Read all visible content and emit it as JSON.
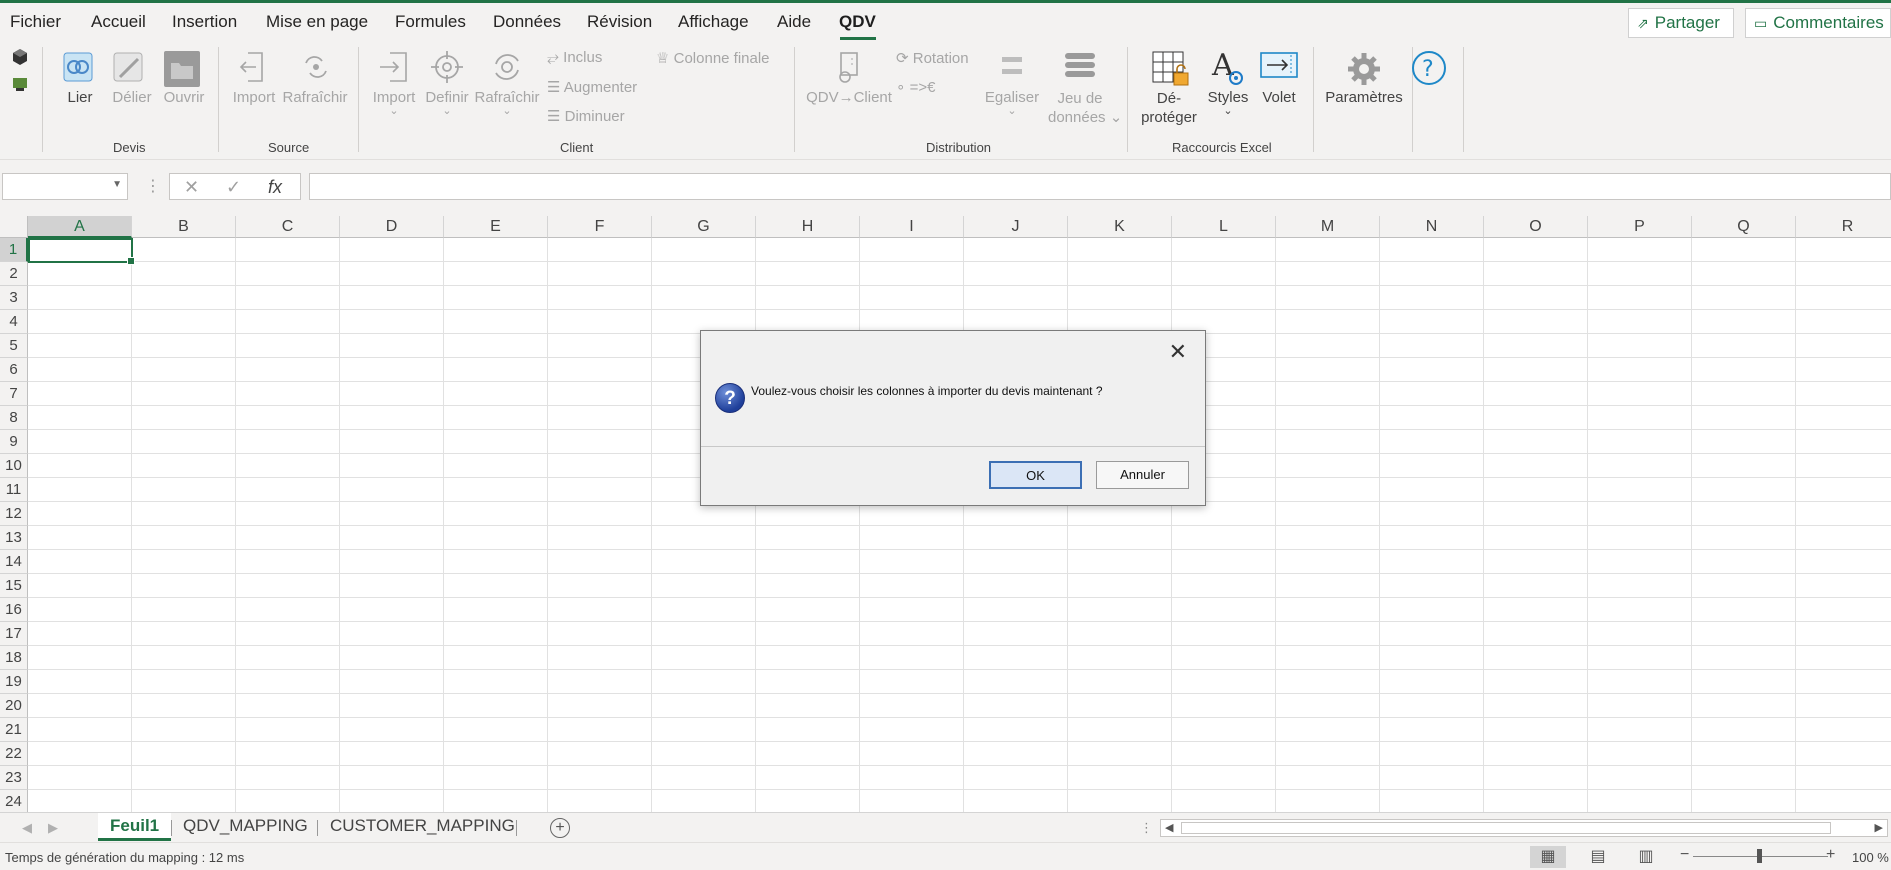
{
  "menu": {
    "items": [
      "Fichier",
      "Accueil",
      "Insertion",
      "Mise en page",
      "Formules",
      "Données",
      "Révision",
      "Affichage",
      "Aide",
      "QDV"
    ],
    "active": "QDV",
    "share_label": "Partager",
    "comments_label": "Commentaires"
  },
  "ribbon": {
    "devis": {
      "label": "Devis",
      "lier": "Lier",
      "delier": "Délier",
      "ouvrir": "Ouvrir"
    },
    "source": {
      "label": "Source",
      "import": "Import",
      "rafraichir": "Rafraîchir"
    },
    "client": {
      "label": "Client",
      "import": "Import",
      "definir": "Definir",
      "rafraichir": "Rafraîchir",
      "inclus": "Inclus",
      "augmenter": "Augmenter",
      "diminuer": "Diminuer",
      "colonne_finale": "Colonne finale"
    },
    "distribution": {
      "label": "Distribution",
      "qdv_client": "QDV→Client",
      "rotation": "Rotation",
      "euro": "=>€",
      "egaliser": "Egaliser",
      "jeu_1": "Jeu de",
      "jeu_2": "données"
    },
    "raccourcis": {
      "label": "Raccourcis Excel",
      "deproteger_1": "Dé-",
      "deproteger_2": "protéger",
      "styles": "Styles",
      "volet": "Volet"
    },
    "parametres": "Paramètres"
  },
  "formula_bar": {
    "name_box": "",
    "formula": ""
  },
  "grid": {
    "columns": [
      "A",
      "B",
      "C",
      "D",
      "E",
      "F",
      "G",
      "H",
      "I",
      "J",
      "K",
      "L",
      "M",
      "N",
      "O",
      "P",
      "Q",
      "R"
    ],
    "rows": [
      "1",
      "2",
      "3",
      "4",
      "5",
      "6",
      "7",
      "8",
      "9",
      "10",
      "11",
      "12",
      "13",
      "14",
      "15",
      "16",
      "17",
      "18",
      "19",
      "20",
      "21",
      "22",
      "23",
      "24"
    ],
    "active_cell": "A1"
  },
  "sheets": {
    "tabs": [
      "Feuil1",
      "QDV_MAPPING",
      "CUSTOMER_MAPPING"
    ],
    "active": "Feuil1"
  },
  "status": {
    "text": "Temps de génération du mapping : 12 ms",
    "zoom": "100 %"
  },
  "dialog": {
    "message": "Voulez-vous choisir les colonnes à importer du devis maintenant ?",
    "ok": "OK",
    "cancel": "Annuler",
    "icon": "question-icon"
  },
  "colors": {
    "accent": "#217346",
    "dialog_button_focus": "#3c6fb4"
  }
}
